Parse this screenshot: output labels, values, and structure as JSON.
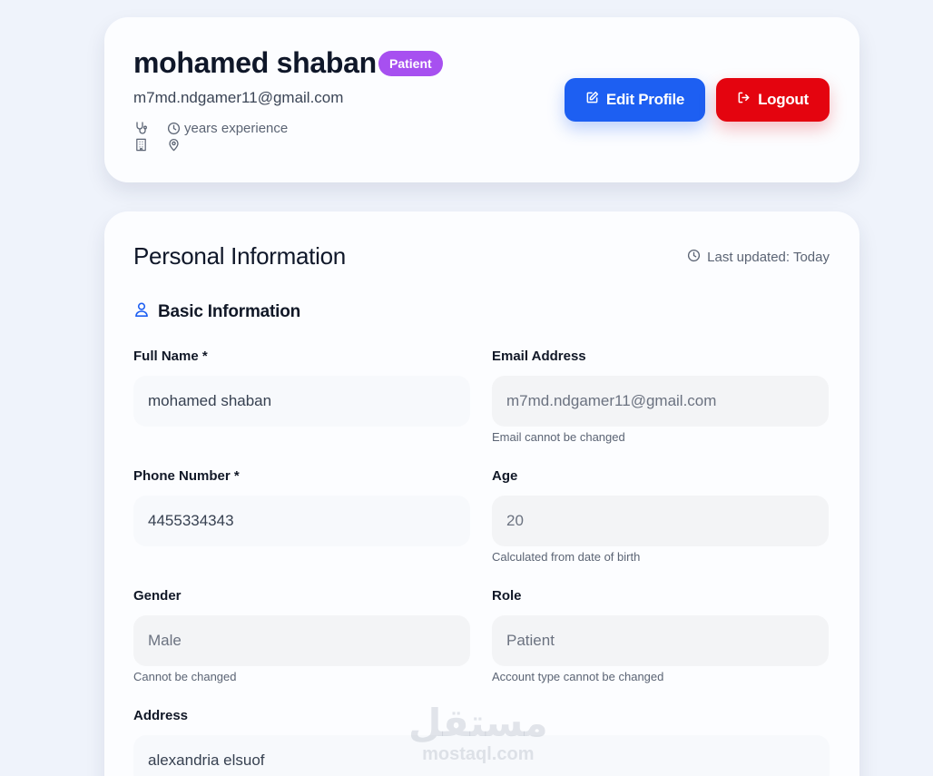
{
  "profile": {
    "name": "mohamed shaban",
    "role_badge": "Patient",
    "email": "m7md.ndgamer11@gmail.com",
    "experience_text": "years experience",
    "edit_label": "Edit Profile",
    "logout_label": "Logout"
  },
  "personal_info": {
    "title": "Personal Information",
    "last_updated": "Last updated: Today",
    "basic_info_title": "Basic Information",
    "fields": {
      "full_name": {
        "label": "Full Name *",
        "value": "mohamed shaban"
      },
      "email": {
        "label": "Email Address",
        "value": "m7md.ndgamer11@gmail.com",
        "hint": "Email cannot be changed"
      },
      "phone": {
        "label": "Phone Number *",
        "value": "4455334343"
      },
      "age": {
        "label": "Age",
        "value": "20",
        "hint": "Calculated from date of birth"
      },
      "gender": {
        "label": "Gender",
        "value": "Male",
        "hint": "Cannot be changed"
      },
      "role": {
        "label": "Role",
        "value": "Patient",
        "hint": "Account type cannot be changed"
      },
      "address": {
        "label": "Address",
        "value": "alexandria elsuof"
      }
    }
  },
  "watermark": {
    "arabic": "مستقل",
    "latin": "mostaql.com"
  },
  "colors": {
    "page_bg": "#eff3fb",
    "badge": "#a750f0",
    "edit_button": "#1d5ff2",
    "logout_button": "#e4040f",
    "icon_accent": "#1d5ff2"
  },
  "icons": [
    "stethoscope-icon",
    "clock-icon",
    "building-icon",
    "map-pin-icon",
    "edit-icon",
    "logout-icon",
    "user-icon"
  ]
}
